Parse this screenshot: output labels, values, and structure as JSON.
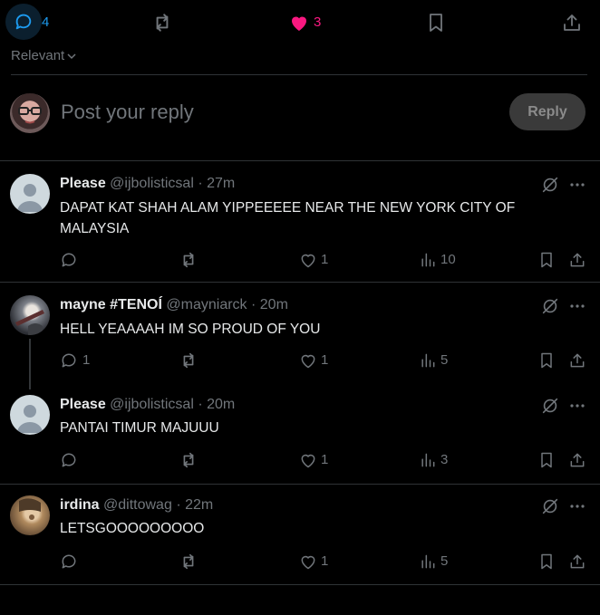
{
  "actions": {
    "reply_count": "4",
    "like_count": "3",
    "accent": "#1d9bf0",
    "like_color": "#f91880"
  },
  "sort": {
    "label": "Relevant"
  },
  "composer": {
    "placeholder": "Post your reply",
    "button": "Reply"
  },
  "replies": [
    {
      "name": "Please",
      "handle": "@ijbolisticsal",
      "time": "27m",
      "text": "DAPAT KAT SHAH ALAM YIPPEEEEE NEAR THE NEW YORK CITY OF MALAYSIA",
      "replies": "",
      "likes": "1",
      "views": "10",
      "avatar": "default-avatar"
    },
    {
      "name": "mayne #TENOÍ",
      "handle": "@mayniarck",
      "time": "20m",
      "text": "HELL YEAAAAH IM SO PROUD OF YOU",
      "replies": "1",
      "likes": "1",
      "views": "5",
      "avatar": "user-photo-avatar"
    },
    {
      "name": "Please",
      "handle": "@ijbolisticsal",
      "time": "20m",
      "text": "PANTAI TIMUR MAJUUU",
      "replies": "",
      "likes": "1",
      "views": "3",
      "avatar": "default-avatar"
    },
    {
      "name": "irdina",
      "handle": "@dittowag",
      "time": "22m",
      "text": "LETSGOOOOOOOOO",
      "replies": "",
      "likes": "1",
      "views": "5",
      "avatar": "user-photo-avatar"
    }
  ]
}
